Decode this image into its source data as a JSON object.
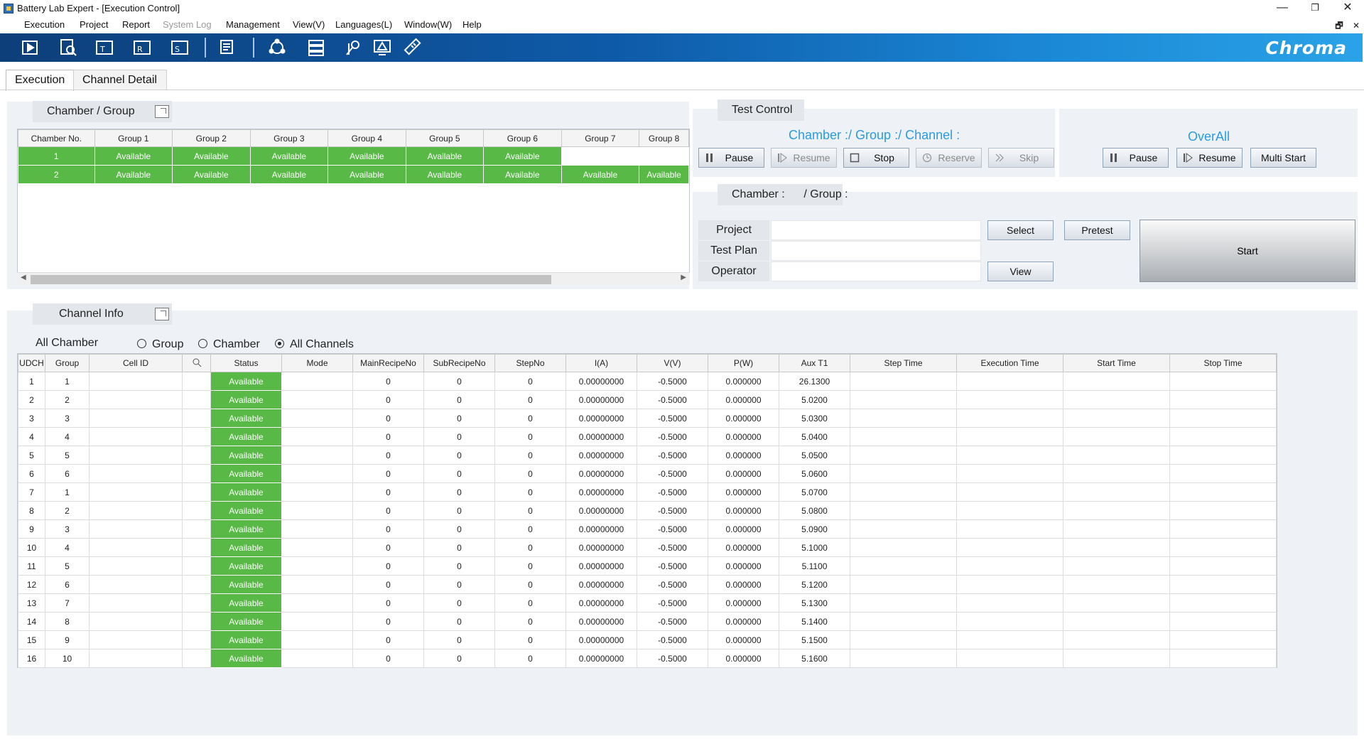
{
  "window": {
    "title": "Battery Lab Expert - [Execution Control]",
    "minimize": "—",
    "restore": "❐",
    "close": "✕"
  },
  "menu": {
    "items": [
      "Execution",
      "Project",
      "Report",
      "System Log",
      "Management",
      "View(V)",
      "Languages(L)",
      "Window(W)",
      "Help"
    ],
    "mdi_restore": "🗗",
    "mdi_close": "✕"
  },
  "toolbar": {
    "brand": "Chroma",
    "icons": [
      "execution-icon",
      "search-report-icon",
      "test-plan-icon",
      "recipe-icon",
      "schedule-icon",
      "log-icon",
      "network-icon",
      "server-icon",
      "tools-icon",
      "alarm-monitor-icon",
      "calibration-icon"
    ]
  },
  "tabs": {
    "execution": "Execution",
    "channel_detail": "Channel Detail"
  },
  "chamber_group": {
    "header": "Chamber / Group",
    "columns": [
      "Chamber No.",
      "Group 1",
      "Group 2",
      "Group 3",
      "Group 4",
      "Group 5",
      "Group 6",
      "Group 7",
      "Group 8"
    ],
    "rows": [
      [
        "1",
        "Available",
        "Available",
        "Available",
        "Available",
        "Available",
        "Available",
        "",
        ""
      ],
      [
        "2",
        "Available",
        "Available",
        "Available",
        "Available",
        "Available",
        "Available",
        "Available",
        "Available"
      ]
    ]
  },
  "test_control": {
    "header": "Test Control",
    "selection_title": "Chamber :/ Group :/ Channel :",
    "pause": "Pause",
    "resume": "Resume",
    "stop": "Stop",
    "reserve": "Reserve",
    "skip": "Skip",
    "overall_title": "OverAll",
    "overall_pause": "Pause",
    "overall_resume": "Resume",
    "multi_start": "Multi Start",
    "chamber_group_label": "Chamber :      / Group :",
    "project_label": "Project",
    "test_plan_label": "Test Plan",
    "operator_label": "Operator",
    "project_value": "",
    "test_plan_value": "",
    "operator_value": "",
    "select": "Select",
    "pretest": "Pretest",
    "view": "View",
    "start": "Start"
  },
  "channel_info": {
    "header": "Channel Info",
    "all_chamber": "All Chamber",
    "radio_group": "Group",
    "radio_chamber": "Chamber",
    "radio_all_channels": "All Channels",
    "selected": "All Channels",
    "columns": [
      "UDCH",
      "Group",
      "Cell ID",
      "",
      "Status",
      "Mode",
      "MainRecipeNo",
      "SubRecipeNo",
      "StepNo",
      "I(A)",
      "V(V)",
      "P(W)",
      "Aux T1",
      "Step Time",
      "Execution Time",
      "Start Time",
      "Stop Time"
    ],
    "rows": [
      [
        "1",
        "1",
        "",
        "",
        "Available",
        "",
        "0",
        "0",
        "0",
        "0.00000000",
        "-0.5000",
        "0.000000",
        "26.1300",
        "",
        "",
        "",
        ""
      ],
      [
        "2",
        "2",
        "",
        "",
        "Available",
        "",
        "0",
        "0",
        "0",
        "0.00000000",
        "-0.5000",
        "0.000000",
        "5.0200",
        "",
        "",
        "",
        ""
      ],
      [
        "3",
        "3",
        "",
        "",
        "Available",
        "",
        "0",
        "0",
        "0",
        "0.00000000",
        "-0.5000",
        "0.000000",
        "5.0300",
        "",
        "",
        "",
        ""
      ],
      [
        "4",
        "4",
        "",
        "",
        "Available",
        "",
        "0",
        "0",
        "0",
        "0.00000000",
        "-0.5000",
        "0.000000",
        "5.0400",
        "",
        "",
        "",
        ""
      ],
      [
        "5",
        "5",
        "",
        "",
        "Available",
        "",
        "0",
        "0",
        "0",
        "0.00000000",
        "-0.5000",
        "0.000000",
        "5.0500",
        "",
        "",
        "",
        ""
      ],
      [
        "6",
        "6",
        "",
        "",
        "Available",
        "",
        "0",
        "0",
        "0",
        "0.00000000",
        "-0.5000",
        "0.000000",
        "5.0600",
        "",
        "",
        "",
        ""
      ],
      [
        "7",
        "1",
        "",
        "",
        "Available",
        "",
        "0",
        "0",
        "0",
        "0.00000000",
        "-0.5000",
        "0.000000",
        "5.0700",
        "",
        "",
        "",
        ""
      ],
      [
        "8",
        "2",
        "",
        "",
        "Available",
        "",
        "0",
        "0",
        "0",
        "0.00000000",
        "-0.5000",
        "0.000000",
        "5.0800",
        "",
        "",
        "",
        ""
      ],
      [
        "9",
        "3",
        "",
        "",
        "Available",
        "",
        "0",
        "0",
        "0",
        "0.00000000",
        "-0.5000",
        "0.000000",
        "5.0900",
        "",
        "",
        "",
        ""
      ],
      [
        "10",
        "4",
        "",
        "",
        "Available",
        "",
        "0",
        "0",
        "0",
        "0.00000000",
        "-0.5000",
        "0.000000",
        "5.1000",
        "",
        "",
        "",
        ""
      ],
      [
        "11",
        "5",
        "",
        "",
        "Available",
        "",
        "0",
        "0",
        "0",
        "0.00000000",
        "-0.5000",
        "0.000000",
        "5.1100",
        "",
        "",
        "",
        ""
      ],
      [
        "12",
        "6",
        "",
        "",
        "Available",
        "",
        "0",
        "0",
        "0",
        "0.00000000",
        "-0.5000",
        "0.000000",
        "5.1200",
        "",
        "",
        "",
        ""
      ],
      [
        "13",
        "7",
        "",
        "",
        "Available",
        "",
        "0",
        "0",
        "0",
        "0.00000000",
        "-0.5000",
        "0.000000",
        "5.1300",
        "",
        "",
        "",
        ""
      ],
      [
        "14",
        "8",
        "",
        "",
        "Available",
        "",
        "0",
        "0",
        "0",
        "0.00000000",
        "-0.5000",
        "0.000000",
        "5.1400",
        "",
        "",
        "",
        ""
      ],
      [
        "15",
        "9",
        "",
        "",
        "Available",
        "",
        "0",
        "0",
        "0",
        "0.00000000",
        "-0.5000",
        "0.000000",
        "5.1500",
        "",
        "",
        "",
        ""
      ],
      [
        "16",
        "10",
        "",
        "",
        "Available",
        "",
        "0",
        "0",
        "0",
        "0.00000000",
        "-0.5000",
        "0.000000",
        "5.1600",
        "",
        "",
        "",
        ""
      ]
    ]
  },
  "colors": {
    "available": "#58b947",
    "toolbar_start": "#0d3f7a",
    "toolbar_end": "#2aa3e8",
    "accent_title": "#2a9be0",
    "panel_bg": "#eef2f7"
  }
}
